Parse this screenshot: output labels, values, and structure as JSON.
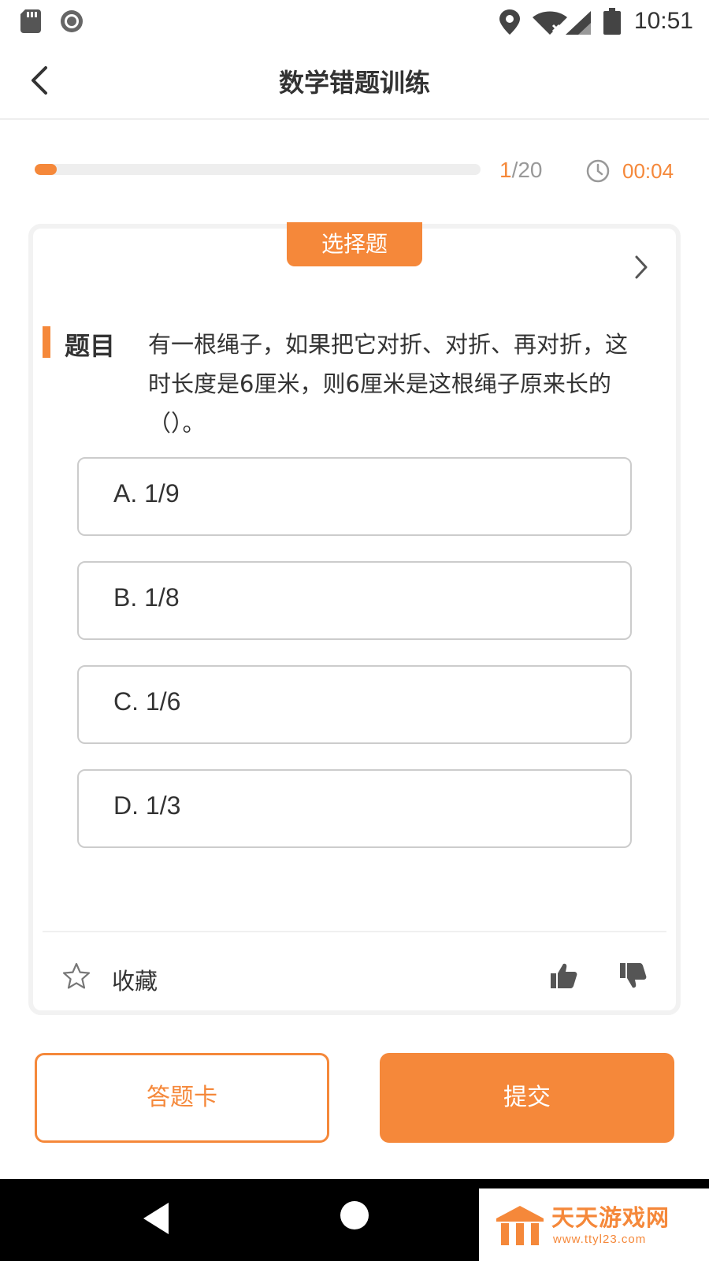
{
  "status_bar": {
    "time": "10:51",
    "icons": [
      "sd-card-icon",
      "record-icon",
      "location-icon",
      "wifi-icon",
      "signal-icon",
      "battery-icon"
    ]
  },
  "header": {
    "title": "数学错题训练",
    "back_icon": "chevron-left-icon"
  },
  "progress": {
    "current": "1",
    "total": "/20",
    "fraction": 0.05,
    "timer": "00:04",
    "timer_icon": "clock-icon"
  },
  "question": {
    "type": "选择题",
    "label": "题目",
    "text": "有一根绳子，如果把它对折、对折、再对折，这时长度是6厘米，则6厘米是这根绳子原来长的（）。",
    "options": [
      {
        "label": "A. 1/9"
      },
      {
        "label": "B. 1/8"
      },
      {
        "label": "C. 1/6"
      },
      {
        "label": "D. 1/3"
      }
    ]
  },
  "actions": {
    "favorite_label": "收藏",
    "favorite_icon": "star-outline-icon",
    "like_icon": "thumbs-up-icon",
    "dislike_icon": "thumbs-down-icon"
  },
  "footer": {
    "answer_card_label": "答题卡",
    "submit_label": "提交"
  },
  "watermark": {
    "name": "天天游戏网",
    "url": "www.ttyl23.com"
  },
  "colors": {
    "accent": "#f5883a",
    "text": "#333333",
    "muted": "#999999",
    "border": "#cccccc"
  }
}
